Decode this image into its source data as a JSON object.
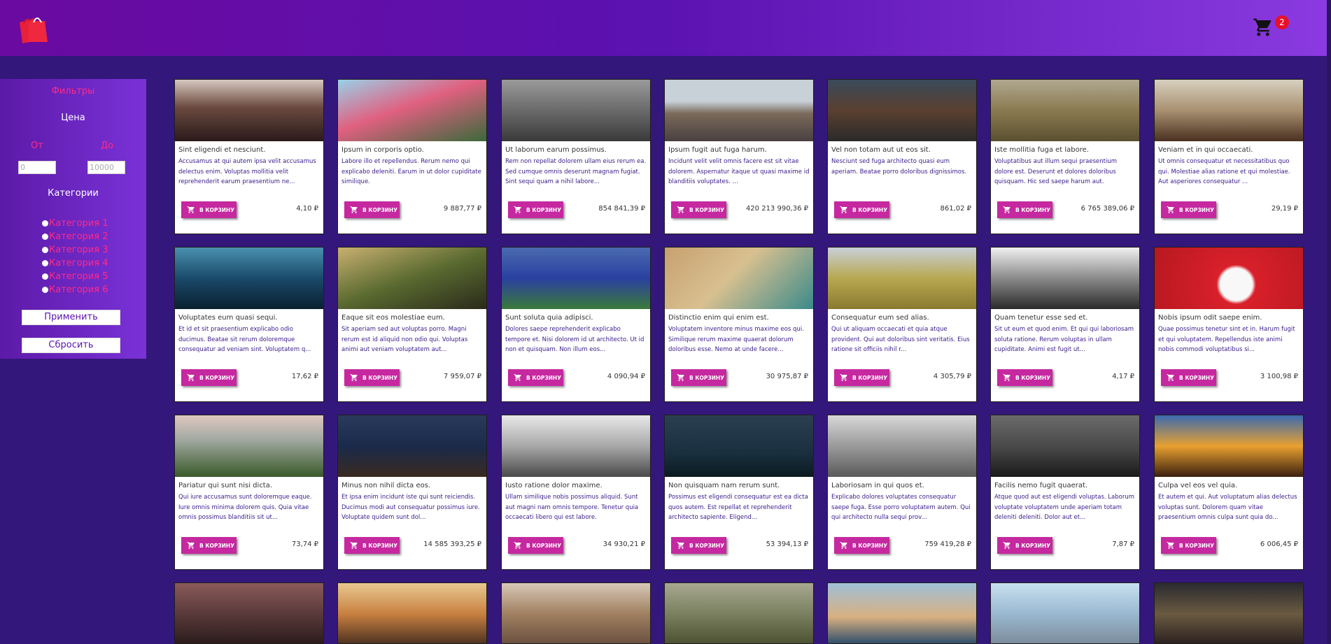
{
  "header": {
    "cart_count": "2"
  },
  "sidebar": {
    "title": "Фильтры",
    "price_label": "Цена",
    "from_label": "От",
    "to_label": "До",
    "from_placeholder": "0",
    "to_placeholder": "10000",
    "categories_label": "Категории",
    "categories": [
      "Категория 1",
      "Категория 2",
      "Категория 3",
      "Категория 4",
      "Категория 5",
      "Категория 6"
    ],
    "apply_label": "Применить",
    "reset_label": "Сбросить"
  },
  "buy_label": "В КОРЗИНУ",
  "products": [
    {
      "title": "Sint eligendi et nesciunt.",
      "desc": "Accusamus at qui autem ipsa velit accusamus delectus enim. Voluptas mollitia velit reprehenderit earum praesentium ne...",
      "price": "4,10 ₽"
    },
    {
      "title": "Ipsum in corporis optio.",
      "desc": "Labore illo et repellendus. Rerum nemo qui explicabo deleniti. Earum in ut dolor cupiditate similique.",
      "price": "9 887,77 ₽"
    },
    {
      "title": "Ut laborum earum possimus.",
      "desc": "Rem non repellat dolorem ullam eius rerum ea. Sed cumque omnis deserunt magnam fugiat. Sint sequi quam a nihil labore...",
      "price": "854 841,39 ₽"
    },
    {
      "title": "Ipsum fugit aut fuga harum.",
      "desc": "Incidunt velit velit omnis facere est sit vitae dolorem. Aspernatur itaque ut quasi maxime id blanditiis voluptates. ...",
      "price": "420 213 990,36 ₽"
    },
    {
      "title": "Vel non totam aut ut eos sit.",
      "desc": "Nesciunt sed fuga architecto quasi eum aperiam. Beatae porro doloribus dignissimos.",
      "price": "861,02 ₽"
    },
    {
      "title": "Iste mollitia fuga et labore.",
      "desc": "Voluptatibus aut illum sequi praesentium dolore est. Deserunt et dolores doloribus quisquam. Hic sed saepe harum aut.",
      "price": "6 765 389,06 ₽"
    },
    {
      "title": "Veniam et in qui occaecati.",
      "desc": "Ut omnis consequatur et necessitatibus quo qui. Molestiae alias ratione et qui molestiae. Aut asperiores consequatur ...",
      "price": "29,19 ₽"
    },
    {
      "title": "Voluptates eum quasi sequi.",
      "desc": "Et id et sit praesentium explicabo odio ducimus. Beatae sit rerum doloremque consequatur ad veniam sint. Voluptatem q...",
      "price": "17,62 ₽"
    },
    {
      "title": "Eaque sit eos molestiae eum.",
      "desc": "Sit aperiam sed aut voluptas porro. Magni rerum est id aliquid non odio qui. Voluptas animi aut veniam voluptatem aut...",
      "price": "7 959,07 ₽"
    },
    {
      "title": "Sunt soluta quia adipisci.",
      "desc": "Dolores saepe reprehenderit explicabo tempore et. Nisi dolorem id ut architecto. Ut id non et quisquam. Non illum eos...",
      "price": "4 090,94 ₽"
    },
    {
      "title": "Distinctio enim qui enim est.",
      "desc": "Voluptatem inventore minus maxime eos qui. Similique rerum maxime quaerat dolorum doloribus esse. Nemo at unde facere...",
      "price": "30 975,87 ₽"
    },
    {
      "title": "Consequatur eum sed alias.",
      "desc": "Qui ut aliquam occaecati et quia atque provident. Qui aut doloribus sint veritatis. Eius ratione sit officiis nihil r...",
      "price": "4 305,79 ₽"
    },
    {
      "title": "Quam tenetur esse sed et.",
      "desc": "Sit ut eum et quod enim. Et qui qui laboriosam soluta ratione. Rerum voluptas in ullam cupiditate. Animi est fugit ut...",
      "price": "4,17 ₽"
    },
    {
      "title": "Nobis ipsum odit saepe enim.",
      "desc": "Quae possimus tenetur sint et in. Harum fugit et qui voluptatem. Repellendus iste animi nobis commodi voluptatibus si...",
      "price": "3 100,98 ₽"
    },
    {
      "title": "Pariatur qui sunt nisi dicta.",
      "desc": "Qui iure accusamus sunt doloremque eaque. Iure omnis minima dolorem quis. Quia vitae omnis possimus blanditiis sit ut...",
      "price": "73,74 ₽"
    },
    {
      "title": "Minus non nihil dicta eos.",
      "desc": "Et ipsa enim incidunt iste qui sunt reiciendis. Ducimus modi aut consequatur possimus iure. Voluptate quidem sunt dol...",
      "price": "14 585 393,25 ₽"
    },
    {
      "title": "Iusto ratione dolor maxime.",
      "desc": "Ullam similique nobis possimus aliquid. Sunt aut magni nam omnis tempore. Tenetur quia occaecati libero qui est labore.",
      "price": "34 930,21 ₽"
    },
    {
      "title": "Non quisquam nam rerum sunt.",
      "desc": "Possimus est eligendi consequatur est ea dicta quos autem. Est repellat et reprehenderit architecto sapiente. Eligend...",
      "price": "53 394,13 ₽"
    },
    {
      "title": "Laboriosam in qui quos et.",
      "desc": "Explicabo dolores voluptates consequatur saepe fuga. Esse porro voluptatem autem. Qui qui architecto nulla sequi prov...",
      "price": "759 419,28 ₽"
    },
    {
      "title": "Facilis nemo fugit quaerat.",
      "desc": "Atque quod aut est eligendi voluptas. Laborum voluptate voluptatem unde aperiam totam deleniti deleniti. Dolor aut et...",
      "price": "7,87 ₽"
    },
    {
      "title": "Culpa vel eos vel quia.",
      "desc": "Et autem et qui. Aut voluptatum alias delectus voluptas sunt. Dolorem quam vitae praesentium omnis culpa sunt quia do...",
      "price": "6 006,45 ₽"
    }
  ],
  "partial_products": 7
}
